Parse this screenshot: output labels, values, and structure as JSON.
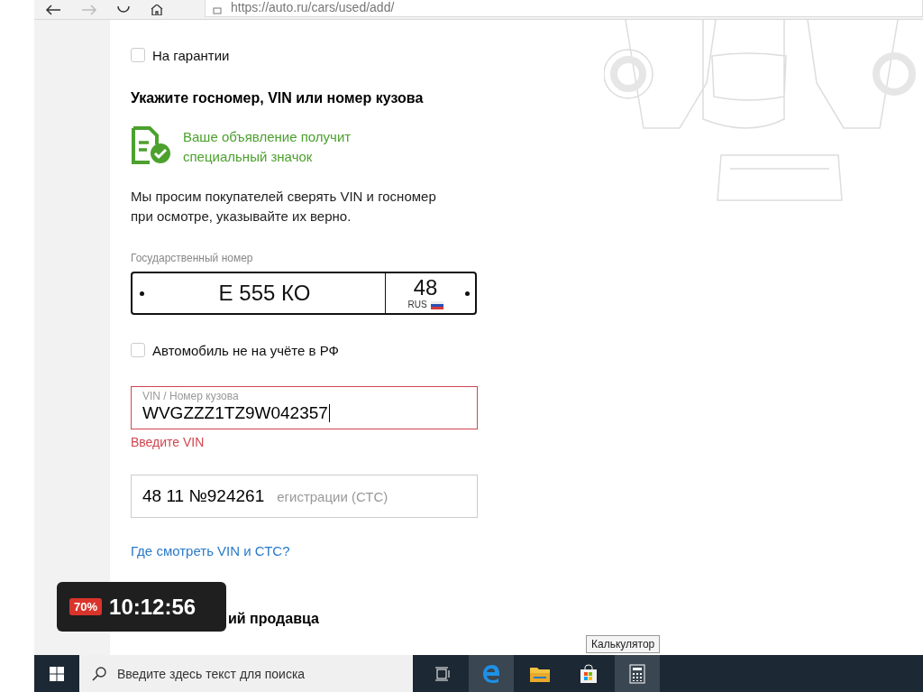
{
  "browser": {
    "url": "https://auto.ru/cars/used/add/"
  },
  "form": {
    "warranty": {
      "label": "На гарантии",
      "checked": false
    },
    "heading": "Укажите госномер, VIN или номер кузова",
    "badge_note": "Ваше объявление получит специальный значок",
    "notice": "Мы просим покупателей сверять VIN и госномер при осмотре, указывайте их верно.",
    "plate": {
      "label": "Государственный номер",
      "number": "Е 555 КО",
      "region": "48",
      "country": "RUS"
    },
    "not_registered": {
      "label": "Автомобиль не на учёте в РФ",
      "checked": false
    },
    "vin": {
      "label": "VIN / Номер кузова",
      "value": "WVGZZZ1TZ9W042357",
      "error": "Введите VIN"
    },
    "sts": {
      "value": "48 11 №924261",
      "placeholder": "егистрации (СТС)"
    },
    "help_link": "Где смотреть VIN и СТС?",
    "next_heading": "ий продавца"
  },
  "timer": {
    "battery": "70%",
    "time": "10:12:56"
  },
  "taskbar": {
    "search_placeholder": "Введите здесь текст для поиска",
    "apps": [
      {
        "kind": "task-view",
        "active": false
      },
      {
        "kind": "edge",
        "active": true
      },
      {
        "kind": "explorer",
        "active": false
      },
      {
        "kind": "store",
        "active": false
      },
      {
        "kind": "calculator",
        "active": true
      }
    ],
    "tooltip": "Калькулятор"
  }
}
